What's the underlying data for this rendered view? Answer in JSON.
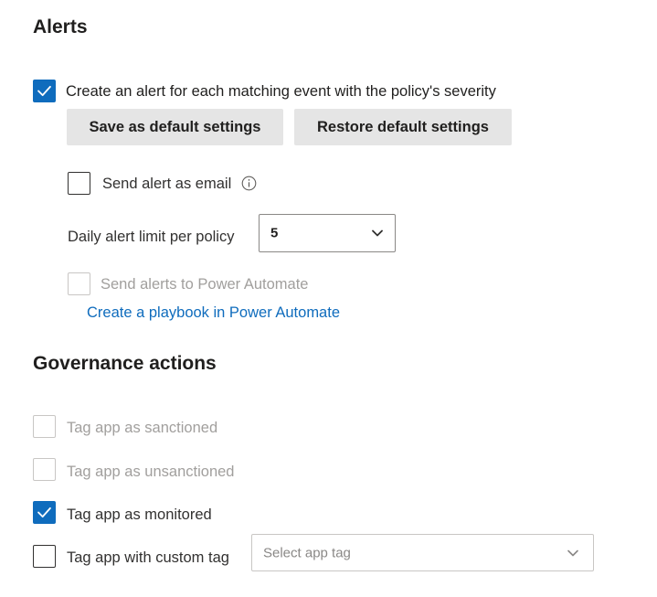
{
  "alerts": {
    "title": "Alerts",
    "create_alert": {
      "label": "Create an alert for each matching event with the policy's severity",
      "checked": true
    },
    "save_default_label": "Save as default settings",
    "restore_default_label": "Restore default settings",
    "send_email": {
      "label": "Send alert as email",
      "checked": false,
      "icon": "info-icon"
    },
    "daily_limit": {
      "label": "Daily alert limit per policy",
      "value": "5",
      "icon": "chevron-down-icon"
    },
    "power_automate": {
      "label": "Send alerts to Power Automate",
      "checked": false,
      "disabled": true
    },
    "playbook_link": "Create a playbook in Power Automate"
  },
  "governance": {
    "title": "Governance actions",
    "actions": [
      {
        "label": "Tag app as sanctioned",
        "checked": false,
        "disabled": true
      },
      {
        "label": "Tag app as unsanctioned",
        "checked": false,
        "disabled": true
      },
      {
        "label": "Tag app as monitored",
        "checked": true,
        "disabled": false
      },
      {
        "label": "Tag app with custom tag",
        "checked": false,
        "disabled": false
      }
    ],
    "custom_tag_placeholder": "Select app tag"
  },
  "colors": {
    "accent": "#0f6cbd",
    "link": "#0f6cbd",
    "button_bg": "#e5e5e5",
    "disabled_text": "#a19f9d"
  }
}
